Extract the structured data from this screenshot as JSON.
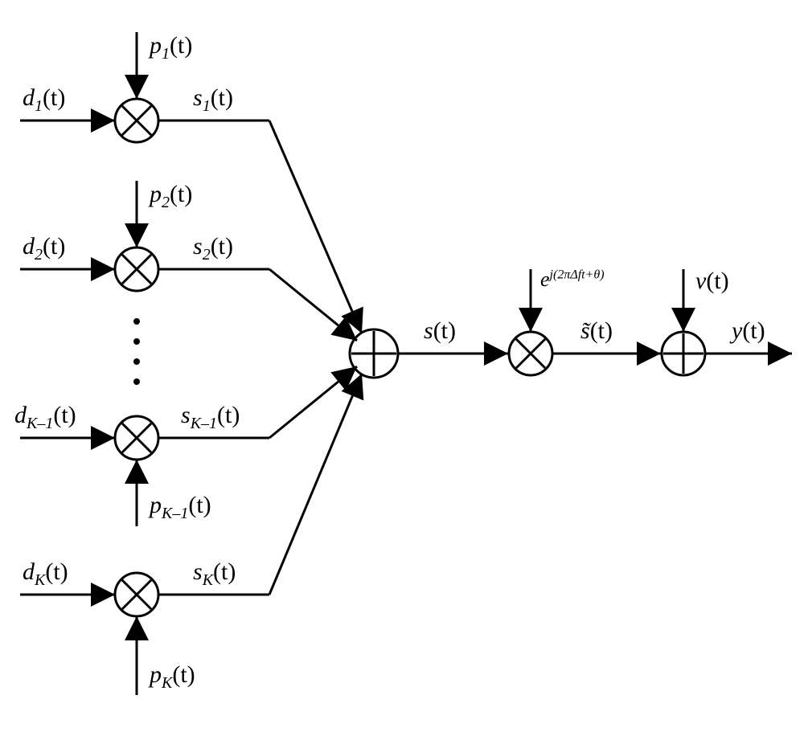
{
  "labels": {
    "p1": "p",
    "p1_sub": "1",
    "p1_arg": "(t)",
    "d1": "d",
    "d1_sub": "1",
    "d1_arg": "(t)",
    "s1": "s",
    "s1_sub": "1",
    "s1_arg": "(t)",
    "p2": "p",
    "p2_sub": "2",
    "p2_arg": "(t)",
    "d2": "d",
    "d2_sub": "2",
    "d2_arg": "(t)",
    "s2": "s",
    "s2_sub": "2",
    "s2_arg": "(t)",
    "dKm1": "d",
    "dKm1_sub": "K–1",
    "dKm1_arg": "(t)",
    "sKm1": "s",
    "sKm1_sub": "K–1",
    "sKm1_arg": "(t)",
    "pKm1": "p",
    "pKm1_sub": "K–1",
    "pKm1_arg": "(t)",
    "dK": "d",
    "dK_sub": "K",
    "dK_arg": "(t)",
    "sK": "s",
    "sK_sub": "K",
    "sK_arg": "(t)",
    "pK": "p",
    "pK_sub": "K",
    "pK_arg": "(t)",
    "s": "s",
    "s_arg": "(t)",
    "exp_base": "e",
    "exp_sup": "j(2πΔft+θ)",
    "stilde": "s̃",
    "stilde_arg": "(t)",
    "v": "v",
    "v_arg": "(t)",
    "y": "y",
    "y_arg": "(t)"
  }
}
